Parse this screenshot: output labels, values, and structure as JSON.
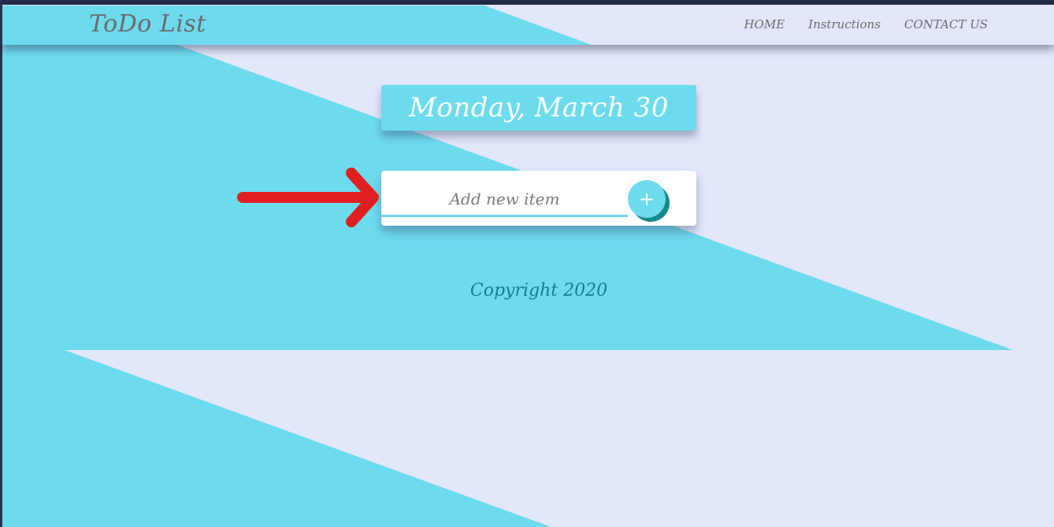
{
  "colors": {
    "accent": "#6ddbee",
    "background": "#e3e7fa",
    "button_shadow": "#138a8d",
    "copyright_text": "#128089",
    "annotation_arrow": "#e02020"
  },
  "navbar": {
    "brand": "ToDo List",
    "links": [
      "HOME",
      "Instructions",
      "CONTACT US"
    ]
  },
  "main": {
    "date": "Monday, March 30",
    "input_placeholder": "Add new item",
    "add_button_label": "+"
  },
  "footer": {
    "copyright": "Copyright 2020"
  },
  "annotation": {
    "icon": "red-arrow-right-icon"
  }
}
